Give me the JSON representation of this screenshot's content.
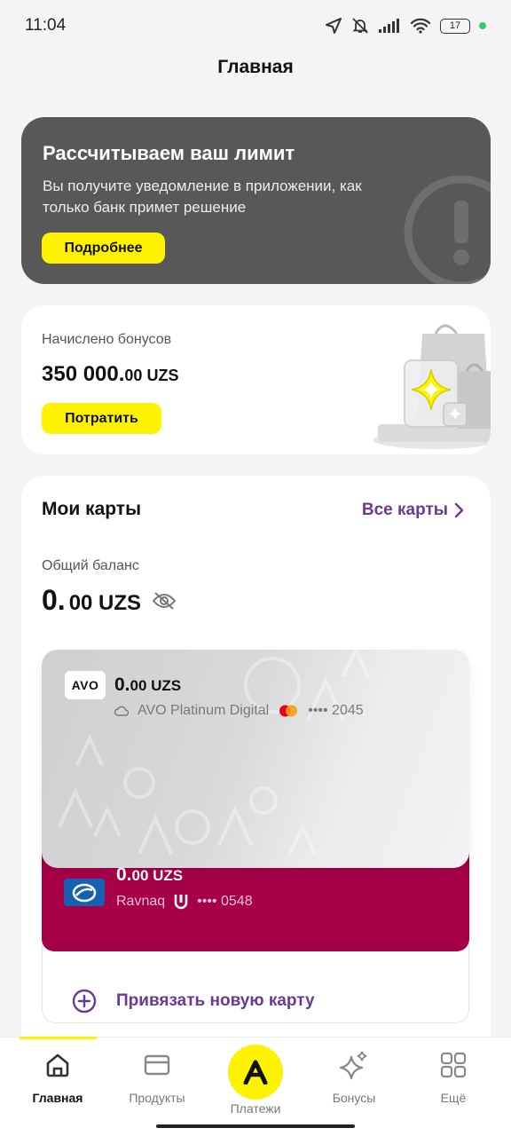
{
  "status": {
    "time": "11:04",
    "battery": "17"
  },
  "page_title": "Главная",
  "limit_card": {
    "title": "Рассчитываем ваш лимит",
    "text": "Вы получите уведомление в приложении, как только банк примет решение",
    "button": "Подробнее"
  },
  "bonus_card": {
    "label": "Начислено бонусов",
    "amount_main": "350 000.",
    "amount_fraction": "00 UZS",
    "button": "Потратить"
  },
  "cards": {
    "title": "Мои карты",
    "all_cards": "Все карты",
    "balance_label": "Общий баланс",
    "balance_main": "0.",
    "balance_fraction": "00 UZS",
    "items": [
      {
        "logo": "AVO",
        "balance_main": "0.",
        "balance_fraction": "00 UZS",
        "name": "AVO Platinum Digital",
        "mask": "•••• 2045",
        "payment_system": "mastercard-icon"
      },
      {
        "logo": "ravnaq-logo",
        "balance_main": "0.",
        "balance_fraction": "00 UZS",
        "name": "Ravnaq",
        "mask": "•••• 0548",
        "payment_system": "uzcard-icon"
      }
    ],
    "add_card": "Привязать новую карту"
  },
  "nav": {
    "items": [
      {
        "label": "Главная",
        "icon": "home-icon"
      },
      {
        "label": "Продукты",
        "icon": "card-icon"
      },
      {
        "label": "Платежи",
        "icon": "payments-icon"
      },
      {
        "label": "Бонусы",
        "icon": "sparkle-icon"
      },
      {
        "label": "Ещё",
        "icon": "grid-icon"
      }
    ]
  },
  "colors": {
    "accent_yellow": "#fff200",
    "accent_purple": "#6a3a93",
    "ravnaq_card": "#a50048",
    "limit_card_bg": "#585858"
  }
}
